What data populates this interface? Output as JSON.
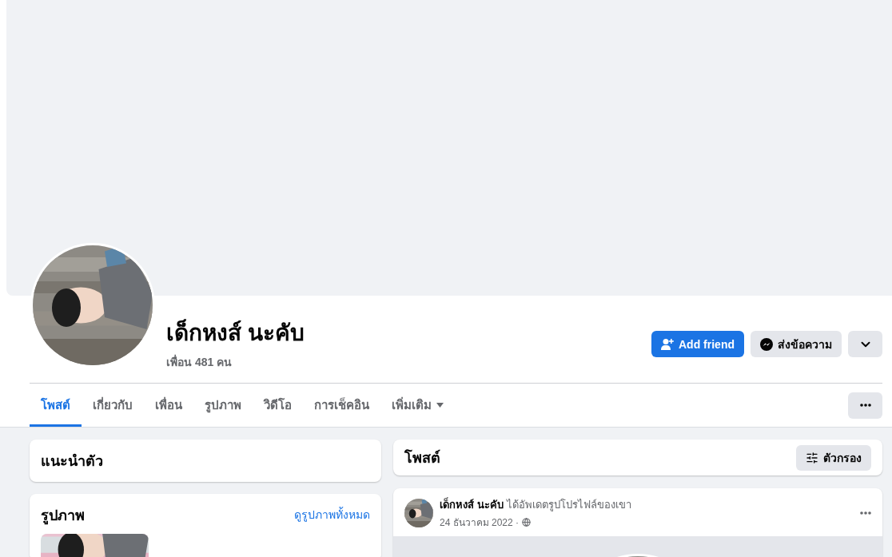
{
  "profile": {
    "name": "เด็กหงส์ นะคับ",
    "friends": "เพื่อน 481 คน"
  },
  "actions": [
    {
      "kind": "primary",
      "label": "Add friend"
    },
    {
      "kind": "secondary",
      "label": "ส่งข้อความ"
    },
    {
      "kind": "menu"
    }
  ],
  "tabs": [
    {
      "kind": "link",
      "label": "โพสต์",
      "selected": true
    },
    {
      "kind": "link",
      "label": "เกี่ยวกับ",
      "selected": false
    },
    {
      "kind": "link",
      "label": "เพื่อน",
      "selected": false
    },
    {
      "kind": "link",
      "label": "รูปภาพ",
      "selected": false
    },
    {
      "kind": "link",
      "label": "วิดีโอ",
      "selected": false
    },
    {
      "kind": "link",
      "label": "การเช็คอิน",
      "selected": false
    },
    {
      "kind": "dropdown",
      "label": "เพิ่มเติม",
      "selected": false
    }
  ],
  "intro": {
    "title": "แนะนำตัว"
  },
  "photos": {
    "title": "รูปภาพ",
    "link": "ดูรูปภาพทั้งหมด"
  },
  "posts_header": {
    "title": "โพสต์",
    "filter": "ตัวกรอง"
  },
  "post": {
    "author": "เด็กหงส์ นะคับ",
    "action": "ได้อัพเดตรูปโปรไฟล์ของเขา",
    "date": "24 ธันวาคม 2022 ·"
  }
}
